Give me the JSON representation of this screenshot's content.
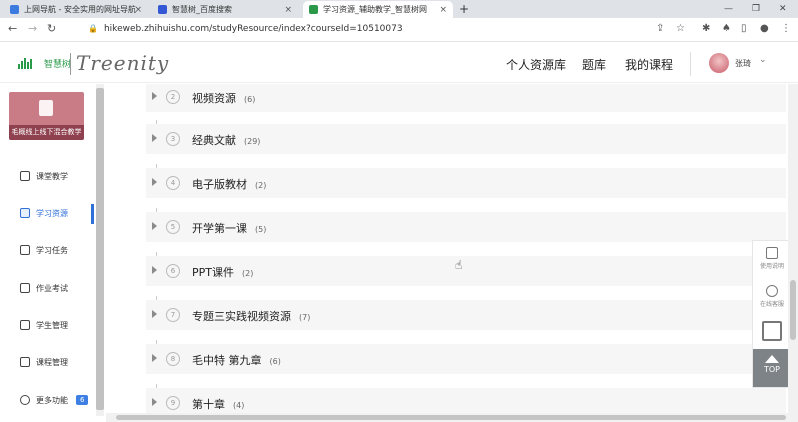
{
  "browser": {
    "tabs": [
      {
        "label": "上网导航 - 安全实用的网址导航",
        "icon_color": "#3b7be0",
        "active": false
      },
      {
        "label": "智慧树_百度搜索",
        "icon_color": "#3457d5",
        "active": false
      },
      {
        "label": "学习资源_辅助教学_智慧树网",
        "icon_color": "#2a9a4a",
        "active": true
      }
    ],
    "new_tab": "+",
    "close": "×",
    "window_controls": {
      "minimize": "—",
      "restore": "❐",
      "close": "✕"
    },
    "url": "hikeweb.zhihuishu.com/studyResource/index?courseId=10510073"
  },
  "header": {
    "logo_text": "智慧树",
    "logo_script": "Treenity",
    "nav": [
      "个人资源库",
      "题库",
      "我的课程"
    ],
    "user_name": "张琦"
  },
  "sidebar": {
    "course_title": "毛概线上线下混合教学",
    "items": [
      {
        "label": "课堂教学",
        "icon": "classroom-icon",
        "active": false
      },
      {
        "label": "学习资源",
        "icon": "resource-icon",
        "active": true
      },
      {
        "label": "学习任务",
        "icon": "task-icon",
        "active": false
      },
      {
        "label": "作业考试",
        "icon": "exam-icon",
        "active": false
      },
      {
        "label": "学生管理",
        "icon": "student-icon",
        "active": false
      },
      {
        "label": "课程管理",
        "icon": "course-manage-icon",
        "active": false
      },
      {
        "label": "更多功能",
        "icon": "more-icon",
        "active": false,
        "badge": "6"
      }
    ]
  },
  "resources": [
    {
      "index": "2",
      "title": "视频资源",
      "count": "(6)"
    },
    {
      "index": "3",
      "title": "经典文献",
      "count": "(29)"
    },
    {
      "index": "4",
      "title": "电子版教材",
      "count": "(2)"
    },
    {
      "index": "5",
      "title": "开学第一课",
      "count": "(5)"
    },
    {
      "index": "6",
      "title": "PPT课件",
      "count": "(2)"
    },
    {
      "index": "7",
      "title": "专题三实践视频资源",
      "count": "(7)"
    },
    {
      "index": "8",
      "title": "毛中特 第九章",
      "count": "(6)"
    },
    {
      "index": "9",
      "title": "第十章",
      "count": "(4)"
    }
  ],
  "float_panel": {
    "help": "使用说明",
    "service": "在线客服",
    "top": "TOP"
  },
  "colors": {
    "accent": "#2f6fd8",
    "brand_green": "#2a9a4a"
  }
}
